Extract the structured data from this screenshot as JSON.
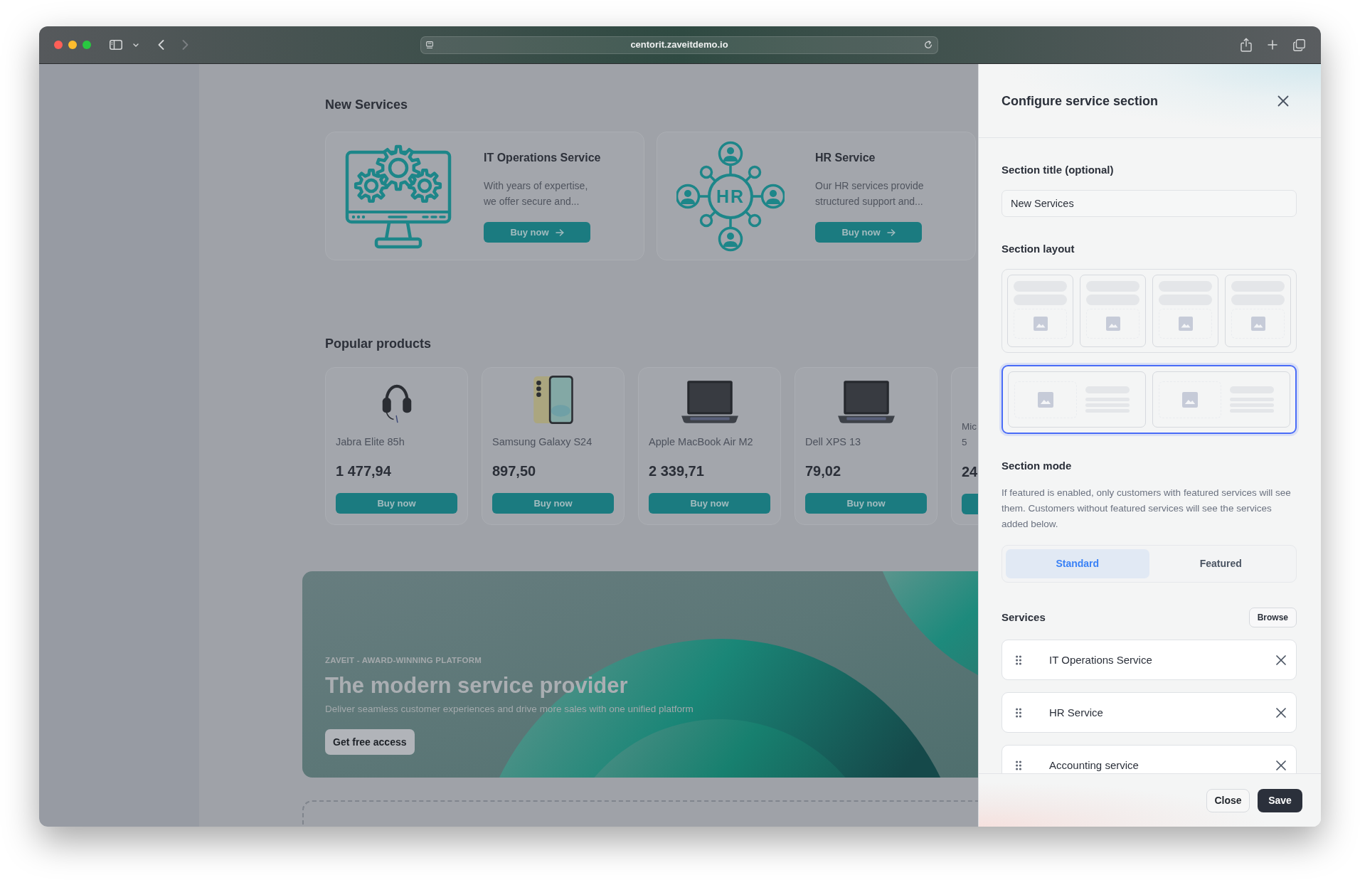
{
  "browser": {
    "url": "centorit.zaveitdemo.io",
    "forward_disabled": true
  },
  "new_services": {
    "title": "New Services",
    "cards": [
      {
        "kind": "computer",
        "title": "IT Operations Service",
        "description": "With years of expertise, we offer secure and...",
        "button": "Buy now"
      },
      {
        "kind": "network",
        "icon_text": "HR",
        "title": "HR Service",
        "description": "Our HR services provide structured support and...",
        "button": "Buy now"
      }
    ]
  },
  "popular_products": {
    "title": "Popular products",
    "products": [
      {
        "kind": "headphones",
        "name": "Jabra Elite 85h",
        "price": "1 477,94",
        "button": "Buy now"
      },
      {
        "kind": "phone",
        "name": "Samsung Galaxy S24",
        "price": "897,50",
        "button": "Buy now"
      },
      {
        "kind": "laptop",
        "name": "Apple MacBook Air M2",
        "price": "2 339,71",
        "button": "Buy now"
      },
      {
        "kind": "laptop",
        "name": "Dell XPS 13",
        "price": "79,02",
        "button": "Buy now"
      },
      {
        "kind": "partial",
        "name_lines": [
          "Mic",
          "5"
        ],
        "price": "24"
      }
    ]
  },
  "banner": {
    "eyebrow": "ZAVEIT - AWARD-WINNING PLATFORM",
    "title": "The modern service provider",
    "subtitle": "Deliver seamless customer experiences and drive more sales with one unified platform",
    "button": "Get free access"
  },
  "panel": {
    "title": "Configure service section",
    "section_title": {
      "label": "Section title (optional)",
      "value": "New Services"
    },
    "layout": {
      "label": "Section layout",
      "options": [
        {
          "kind": "grid",
          "selected": false
        },
        {
          "kind": "list",
          "selected": true
        }
      ]
    },
    "mode": {
      "label": "Section mode",
      "description": "If featured is enabled, only customers with featured services will see them. Customers without featured services will see the services added below.",
      "options": [
        {
          "label": "Standard",
          "selected": true
        },
        {
          "label": "Featured",
          "selected": false
        }
      ]
    },
    "services": {
      "label": "Services",
      "browse_button": "Browse",
      "items": [
        {
          "name": "IT Operations Service"
        },
        {
          "name": "HR Service"
        },
        {
          "name": "Accounting service"
        }
      ]
    },
    "footer": {
      "buttons": [
        {
          "kind": "dismiss",
          "label": "Close"
        },
        {
          "kind": "submit",
          "label": "Save"
        }
      ]
    }
  }
}
